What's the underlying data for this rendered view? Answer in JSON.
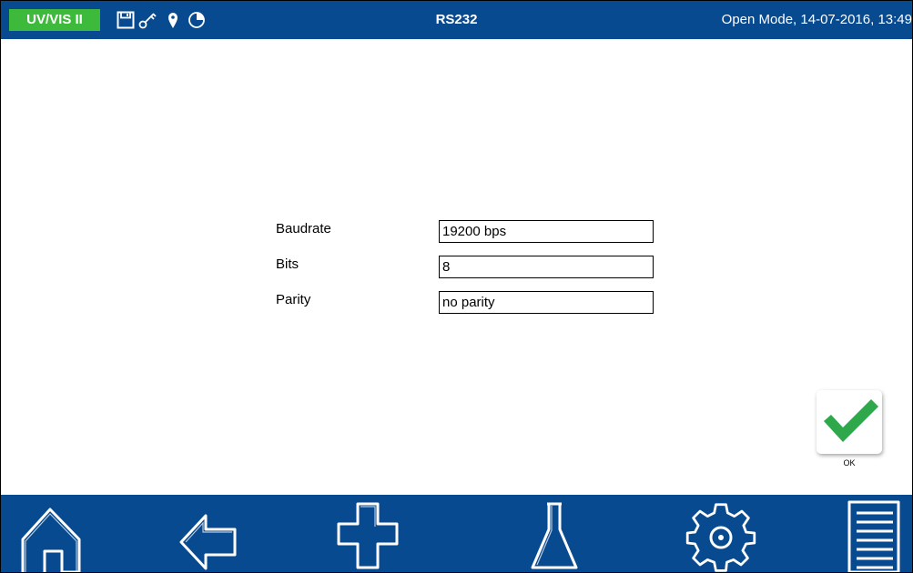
{
  "header": {
    "app_badge": "UV/VIS II",
    "title": "RS232",
    "status_text": "Open Mode, 14-07-2016, 13:49",
    "status_icons": [
      "save-icon",
      "key-icon",
      "location-pin-icon",
      "timer-pie-icon"
    ]
  },
  "form": {
    "baudrate": {
      "label": "Baudrate",
      "value": "19200 bps"
    },
    "bits": {
      "label": "Bits",
      "value": "8"
    },
    "parity": {
      "label": "Parity",
      "value": "no parity"
    }
  },
  "ok_button": {
    "label": "OK",
    "icon": "checkmark-icon"
  },
  "bottom_nav": [
    "home-icon",
    "back-arrow-icon",
    "plus-icon",
    "flask-icon",
    "gear-icon",
    "list-menu-icon"
  ],
  "colors": {
    "bar": "#074a8f",
    "badge": "#3dba3c",
    "check": "#2ea84a",
    "text_light": "#ffffff"
  }
}
